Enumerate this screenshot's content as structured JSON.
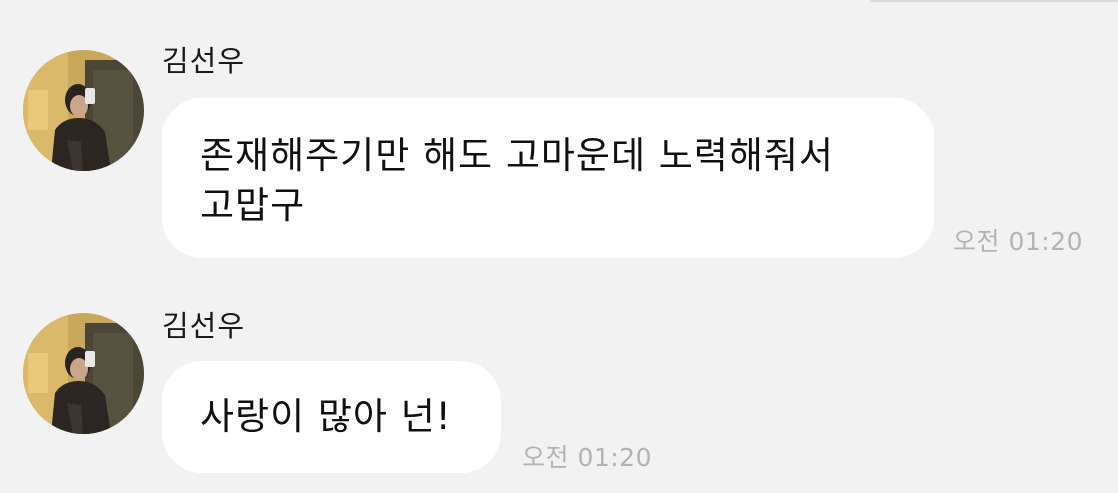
{
  "chat": {
    "messages": [
      {
        "sender": "김선우",
        "text_lines": [
          "존재해주기만 해도 고마운데 노력해줘서",
          "고맙구"
        ],
        "time": "오전 01:20"
      },
      {
        "sender": "김선우",
        "text_lines": [
          "사랑이 많아 넌!"
        ],
        "time": "오전 01:20"
      }
    ]
  },
  "colors": {
    "background": "#f2f2f2",
    "bubble": "#ffffff",
    "text": "#111111",
    "timestamp": "#b3b3b3"
  }
}
